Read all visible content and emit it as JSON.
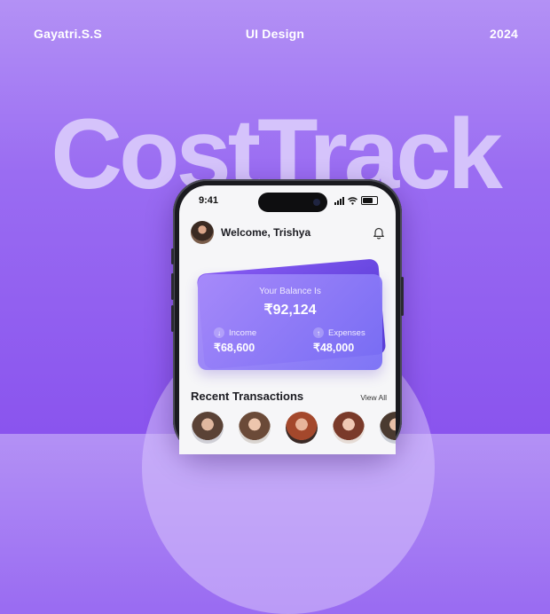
{
  "header": {
    "author": "Gayatri.S.S",
    "category": "UI Design",
    "year": "2024"
  },
  "hero_title": "CostTrack",
  "phone": {
    "status_time": "9:41",
    "welcome_text": "Welcome, Trishya",
    "balance_card": {
      "label": "Your Balance Is",
      "value": "₹92,124",
      "income_label": "Income",
      "income_value": "₹68,600",
      "expenses_label": "Expenses",
      "expenses_value": "₹48,000"
    },
    "recent_title": "Recent Transactions",
    "view_all": "View All"
  },
  "icons": [
    "bell-icon",
    "arrow-down-icon",
    "arrow-up-icon",
    "signal-icon",
    "wifi-icon",
    "battery-icon"
  ],
  "colors": {
    "background": "#9a6cf2",
    "hero_text": "#d5c3fb",
    "card": "#8a7cf6"
  }
}
